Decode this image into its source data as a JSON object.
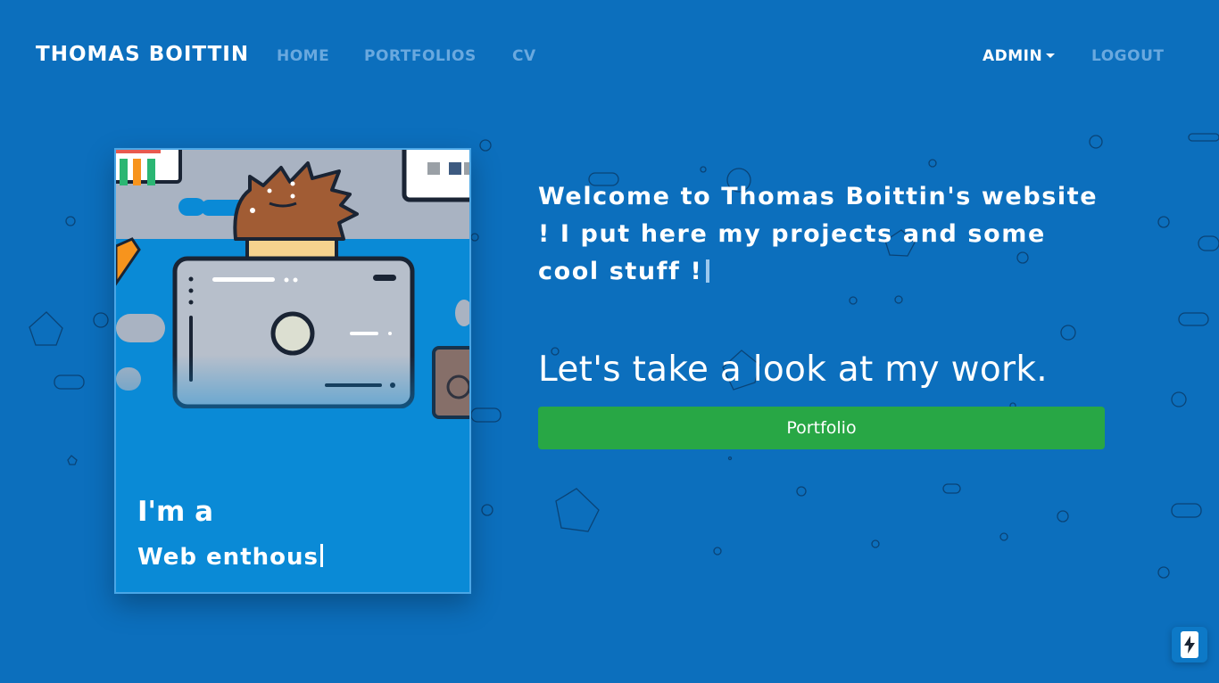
{
  "navbar": {
    "brand": "THOMAS BOITTIN",
    "links": {
      "home": "HOME",
      "portfolios": "PORTFOLIOS",
      "cv": "CV"
    },
    "admin": "ADMIN",
    "logout": "LOGOUT"
  },
  "card": {
    "line1": "I'm a",
    "line2": "Web enthous"
  },
  "hero": {
    "welcome": "Welcome to Thomas Boittin's website ! I put here my projects and some cool stuff !",
    "subtitle": "Let's take a look at my work.",
    "button": "Portfolio"
  },
  "icons": {
    "admin_caret": "chevron-down-icon",
    "badge": "lightning-bolt-icon"
  },
  "colors": {
    "background": "#0c6fbd",
    "card": "#0a8ad6",
    "button": "#28a745",
    "nav_inactive": "#6aa9df"
  }
}
